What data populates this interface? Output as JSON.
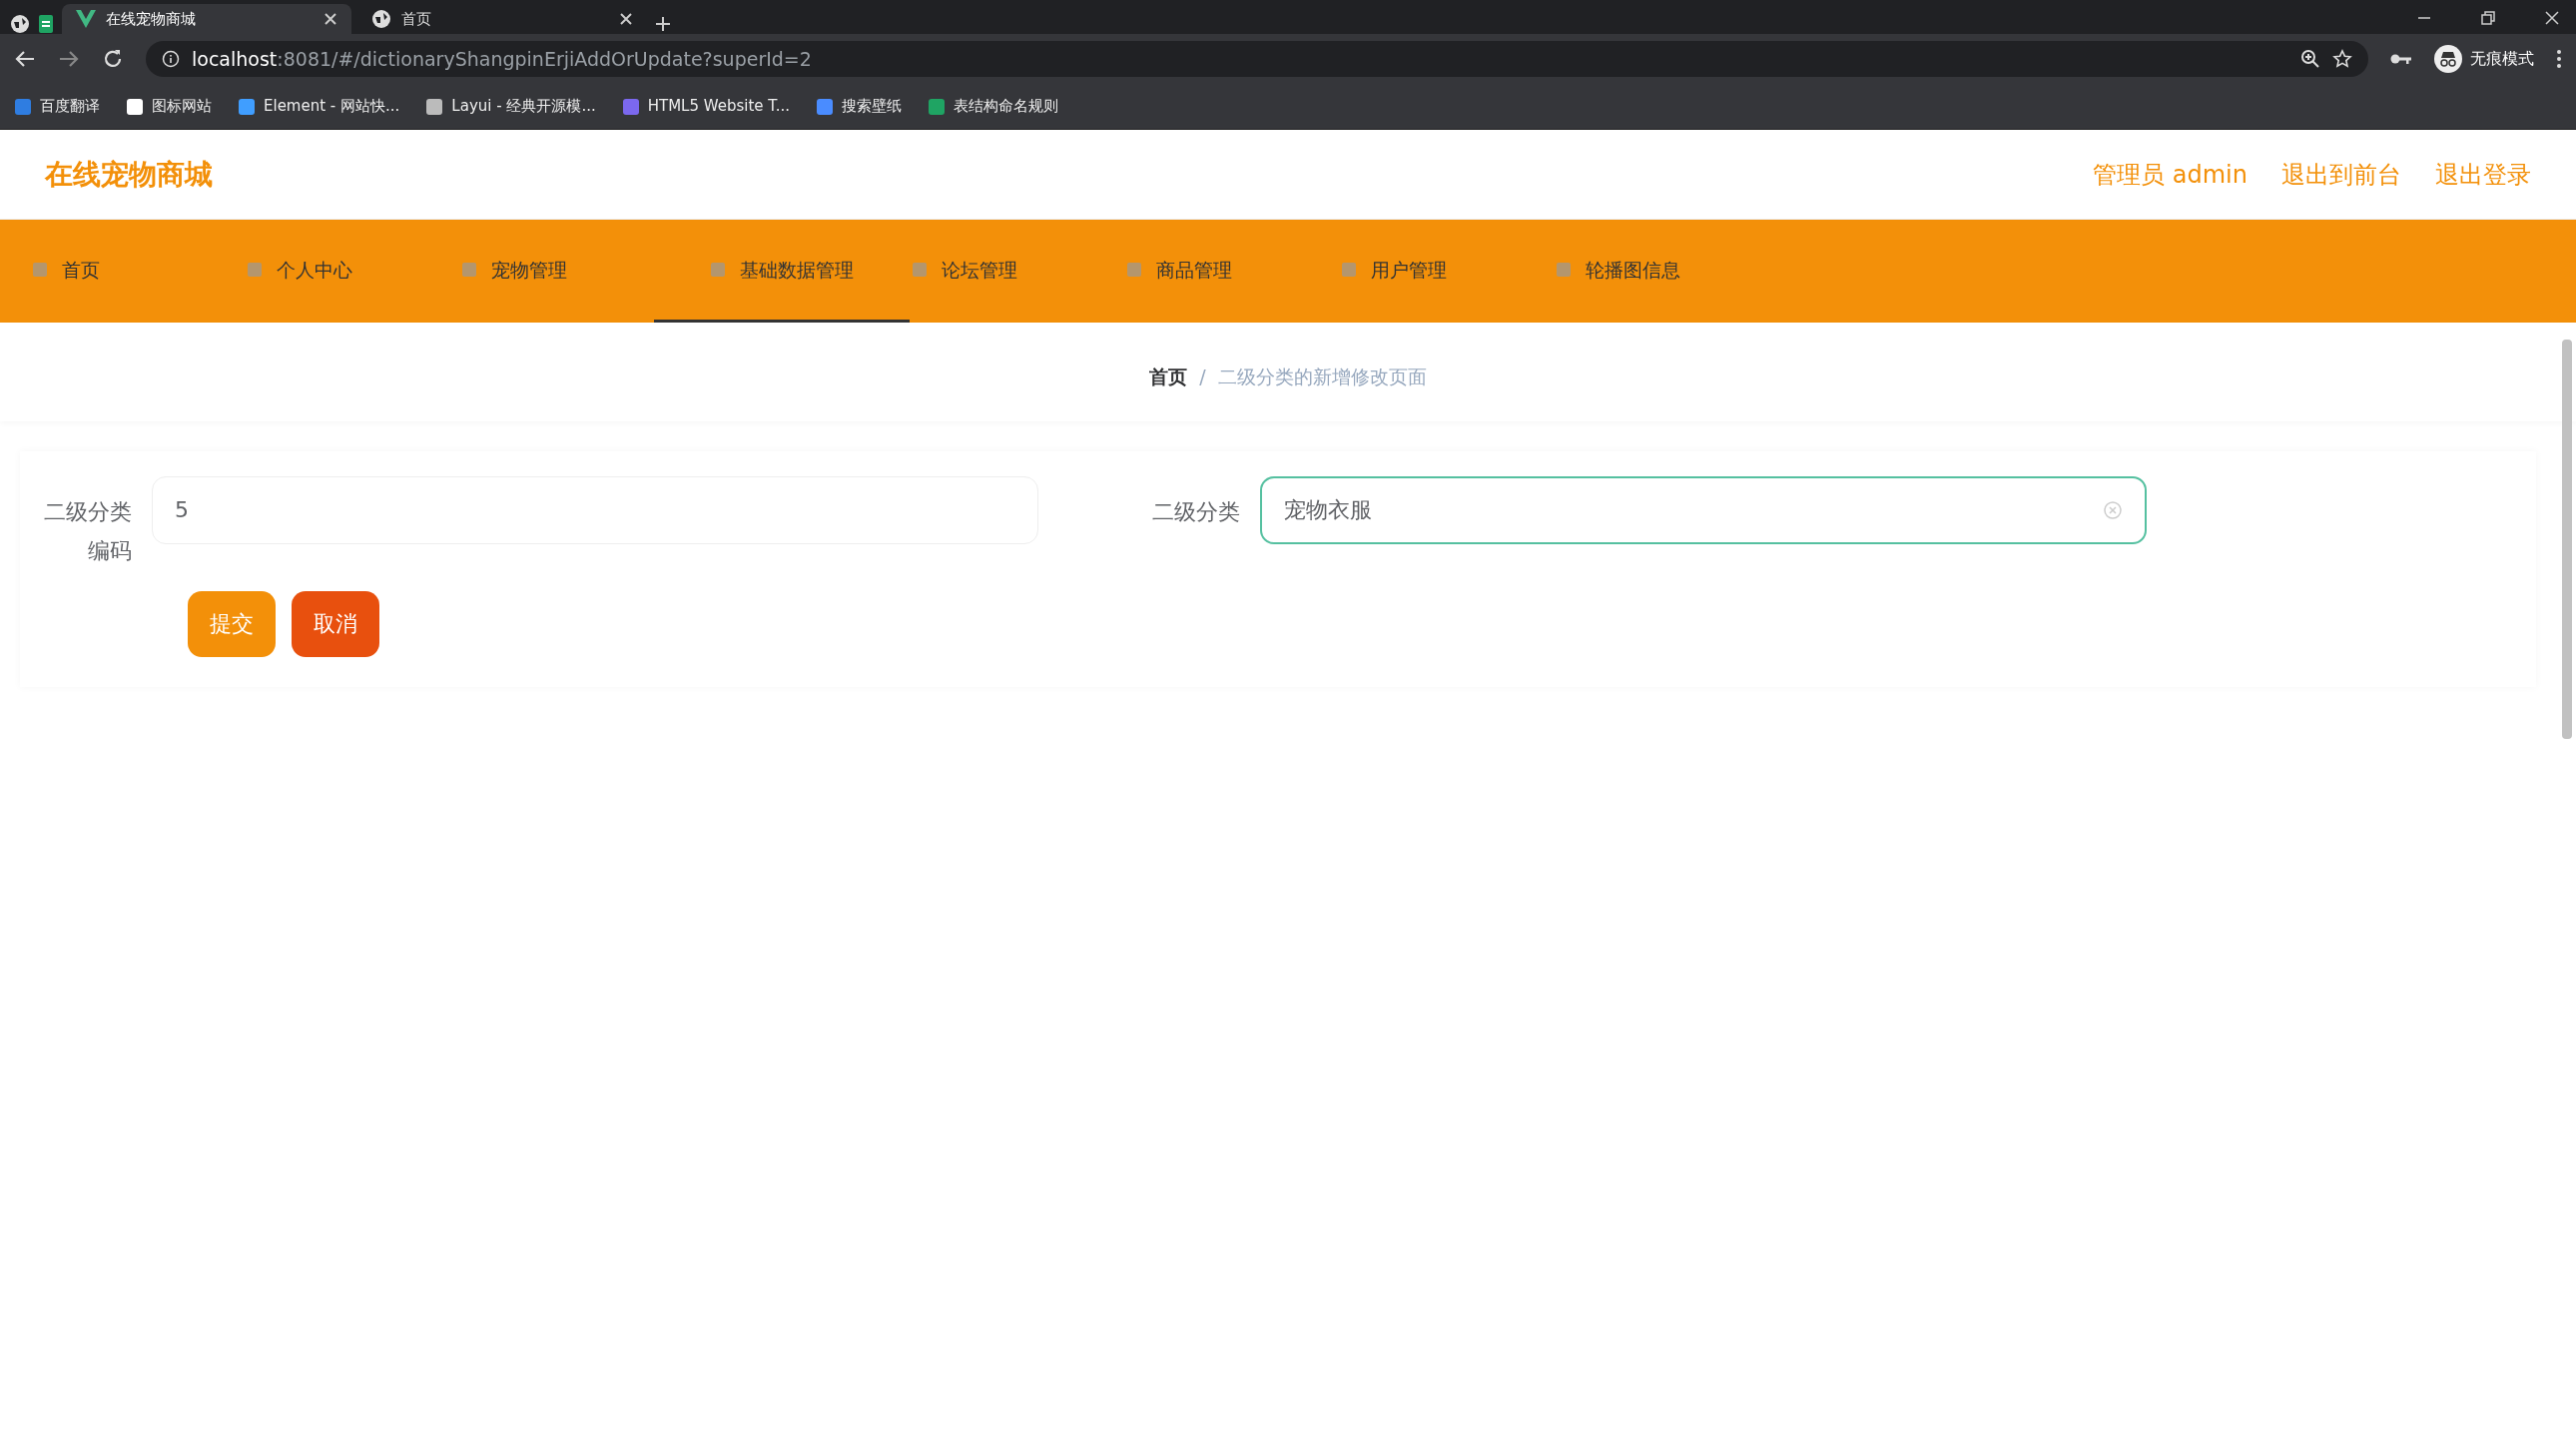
{
  "browser": {
    "tabs": [
      {
        "title": "在线宠物商城",
        "selected": true
      },
      {
        "title": "首页",
        "selected": false
      }
    ],
    "url_host": "localhost",
    "url_rest": ":8081/#/dictionaryShangpinErjiAddOrUpdate?superId=2",
    "bookmarks": [
      {
        "label": "百度翻译",
        "color": "#2f7de1"
      },
      {
        "label": "图标网站",
        "color": "#ffffff"
      },
      {
        "label": "Element - 网站快...",
        "color": "#409eff"
      },
      {
        "label": "Layui - 经典开源模...",
        "color": "#bbbbbb"
      },
      {
        "label": "HTML5 Website T...",
        "color": "#7b68ee"
      },
      {
        "label": "搜索壁纸",
        "color": "#4a8cff"
      },
      {
        "label": "表结构命名规则",
        "color": "#1fa463"
      }
    ],
    "profile_label": "无痕模式"
  },
  "header": {
    "brand": "在线宠物商城",
    "links": [
      "管理员 admin",
      "退出到前台",
      "退出登录"
    ]
  },
  "nav": [
    {
      "label": "首页",
      "selected": false
    },
    {
      "label": "个人中心",
      "selected": false
    },
    {
      "label": "宠物管理",
      "selected": false
    },
    {
      "label": "基础数据管理",
      "selected": true
    },
    {
      "label": "论坛管理",
      "selected": false
    },
    {
      "label": "商品管理",
      "selected": false
    },
    {
      "label": "用户管理",
      "selected": false
    },
    {
      "label": "轮播图信息",
      "selected": false
    }
  ],
  "breadcrumb_separator": "/",
  "breadcrumb": [
    {
      "label": "首页",
      "current": false
    },
    {
      "label": "二级分类的新增修改页面",
      "current": true
    }
  ],
  "form": {
    "fields": [
      {
        "label": "二级分类编码",
        "value": "5",
        "focused": false
      },
      {
        "label": "二级分类",
        "value": "宠物衣服",
        "focused": true
      }
    ],
    "buttons": [
      {
        "label": "提交",
        "kind": "primary"
      },
      {
        "label": "取消",
        "kind": "danger"
      }
    ]
  }
}
